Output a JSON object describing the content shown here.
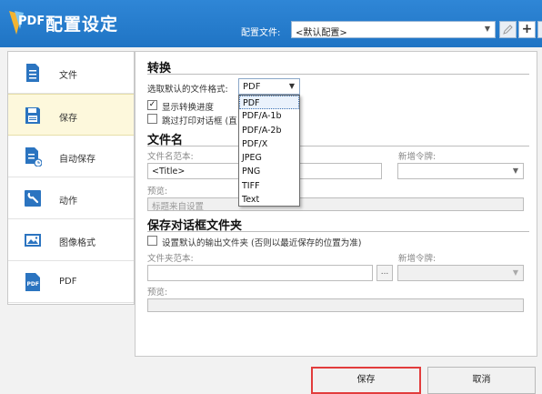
{
  "header": {
    "logo_text": "PDF",
    "title": "配置设定",
    "profile_label": "配置文件:",
    "profile_value": "<默认配置>",
    "add_symbol": "+",
    "more_symbol": "..."
  },
  "sidebar": {
    "items": [
      {
        "label": "文件",
        "icon": "file-icon"
      },
      {
        "label": "保存",
        "icon": "save-icon"
      },
      {
        "label": "自动保存",
        "icon": "autosave-icon"
      },
      {
        "label": "动作",
        "icon": "wrench-icon"
      },
      {
        "label": "图像格式",
        "icon": "image-icon"
      },
      {
        "label": "PDF",
        "icon": "pdf-icon"
      }
    ]
  },
  "convert": {
    "title": "转换",
    "format_label": "选取默认的文件格式:",
    "format_value": "PDF",
    "show_progress_label": "显示转换进度",
    "show_progress_checked": true,
    "skip_print_label": "跳过打印对话框 (直",
    "skip_print_checked": false,
    "format_options": [
      "PDF",
      "PDF/A-1b",
      "PDF/A-2b",
      "PDF/X",
      "JPEG",
      "PNG",
      "TIFF",
      "Text"
    ],
    "selected_option": "PDF"
  },
  "filename": {
    "title": "文件名",
    "template_label": "文件名范本:",
    "template_value": "<Title>",
    "new_token_label": "新增令牌:",
    "preview_label": "预览:",
    "preview_value": "标题来自设置"
  },
  "savedialog": {
    "title": "保存对话框文件夹",
    "set_default_label": "设置默认的输出文件夹 (否则以最近保存的位置为准)",
    "set_default_checked": false,
    "folder_template_label": "文件夹范本:",
    "folder_template_value": "",
    "browse_label": "...",
    "new_token_label": "新增令牌:",
    "preview_label": "预览:",
    "preview_value": ""
  },
  "footer": {
    "save_label": "保存",
    "cancel_label": "取消"
  },
  "colors": {
    "header_blue": "#2179c9",
    "active_item": "#fdf8dc",
    "save_highlight": "#e23c3c"
  }
}
